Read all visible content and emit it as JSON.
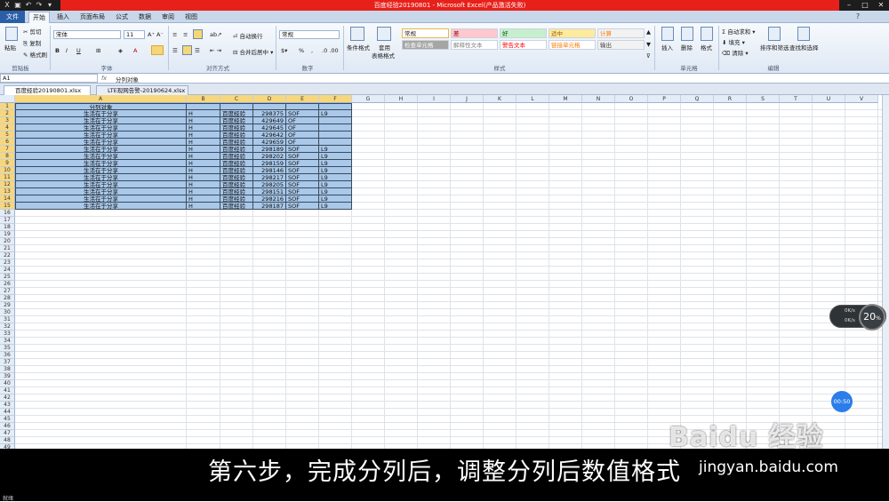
{
  "window": {
    "title": "百度经验20190801 - Microsoft Excel(产品激活失败)"
  },
  "ribbon": {
    "tabs": [
      "文件",
      "开始",
      "插入",
      "页面布局",
      "公式",
      "数据",
      "审阅",
      "视图"
    ],
    "clipboard": {
      "paste": "粘贴",
      "cut": "剪切",
      "copy": "复制",
      "format_painter": "格式刷",
      "group": "剪贴板"
    },
    "font": {
      "name": "宋体",
      "size": "11",
      "group": "字体"
    },
    "alignment": {
      "wrap": "自动换行",
      "merge": "合并后居中",
      "group": "对齐方式"
    },
    "number": {
      "format": "常规",
      "percent": "%",
      "group": "数字"
    },
    "styles": {
      "conditional": "条件格式",
      "table": "套用",
      "table2": "表格格式",
      "cells": [
        {
          "label": "常规",
          "bg": "#ffffff"
        },
        {
          "label": "差",
          "bg": "#ffc7ce"
        },
        {
          "label": "好",
          "bg": "#c6efce"
        },
        {
          "label": "适中",
          "bg": "#ffeb9c"
        },
        {
          "label": "计算",
          "bg": "#f2f2f2"
        },
        {
          "label": "检查单元格",
          "bg": "#a5a5a5"
        },
        {
          "label": "解释性文本",
          "bg": "#ffffff"
        },
        {
          "label": "警告文本",
          "bg": "#ffffff"
        },
        {
          "label": "链接单元格",
          "bg": "#ffffff"
        },
        {
          "label": "输出",
          "bg": "#f2f2f2"
        }
      ],
      "group": "样式"
    },
    "cells_group": {
      "insert": "插入",
      "delete": "删除",
      "format": "格式",
      "group": "单元格"
    },
    "editing": {
      "autosum": "自动求和",
      "fill": "填充",
      "clear": "清除",
      "sort": "排序和筛选",
      "find": "查找和选择",
      "group": "编辑"
    }
  },
  "formula_bar": {
    "name_box": "A1",
    "fx": "fx",
    "content": "分列对象"
  },
  "workbook_tabs": [
    {
      "label": "百度经验20190801.xlsx",
      "active": true
    },
    {
      "label": "LTE现网告警-20190624.xlsx",
      "active": false
    }
  ],
  "columns": [
    "A",
    "B",
    "C",
    "D",
    "E",
    "F",
    "G",
    "H",
    "I",
    "J",
    "K",
    "L",
    "M",
    "N",
    "O",
    "P",
    "Q",
    "R",
    "S",
    "T",
    "U",
    "V"
  ],
  "rows": [
    [
      "分列对象",
      "",
      "",
      "",
      "",
      ""
    ],
    [
      "生活在于分享",
      "H",
      "百度经验",
      "298375",
      "SOF",
      "L9"
    ],
    [
      "生活在于分享",
      "H",
      "百度经验",
      "429649",
      "OF",
      ""
    ],
    [
      "生活在于分享",
      "H",
      "百度经验",
      "429645",
      "OF",
      ""
    ],
    [
      "生活在于分享",
      "H",
      "百度经验",
      "429642",
      "OF",
      ""
    ],
    [
      "生活在于分享",
      "H",
      "百度经验",
      "429659",
      "OF",
      ""
    ],
    [
      "生活在于分享",
      "H",
      "百度经验",
      "298189",
      "SOF",
      "L9"
    ],
    [
      "生活在于分享",
      "H",
      "百度经验",
      "298202",
      "SOF",
      "L9"
    ],
    [
      "生活在于分享",
      "H",
      "百度经验",
      "298159",
      "SOF",
      "L9"
    ],
    [
      "生活在于分享",
      "H",
      "百度经验",
      "298146",
      "SOF",
      "L9"
    ],
    [
      "生活在于分享",
      "H",
      "百度经验",
      "298217",
      "SOF",
      "L9"
    ],
    [
      "生活在于分享",
      "H",
      "百度经验",
      "298205",
      "SOF",
      "L9"
    ],
    [
      "生活在于分享",
      "H",
      "百度经验",
      "298151",
      "SOF",
      "L9"
    ],
    [
      "生活在于分享",
      "H",
      "百度经验",
      "298216",
      "SOF",
      "L9"
    ],
    [
      "生活在于分享",
      "H",
      "百度经验",
      "298187",
      "SOF",
      "L9"
    ]
  ],
  "total_rows": 49,
  "selection_color": "#a9c8ea",
  "subtitle": "第六步，完成分列后，调整分列后数值格式",
  "watermark": {
    "brand": "Baidu 经验",
    "url": "jingyan.baidu.com"
  },
  "status": "就绪",
  "overlay": {
    "speed": "20",
    "speed_unit": "%",
    "up": "0K/s",
    "down": "0K/s",
    "timer": "00:50"
  }
}
